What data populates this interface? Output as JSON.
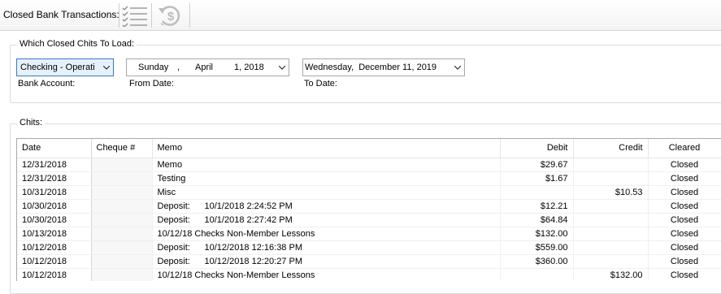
{
  "toolbar": {
    "title": "Closed Bank Transactions:",
    "checklist_icon": "checklist-icon",
    "undo_money_icon": "undo-dollar-icon"
  },
  "load_group": {
    "title": "Which Closed Chits To Load:",
    "bank_account": {
      "value": "Checking - Operati",
      "label": "Bank Account:"
    },
    "from_date": {
      "weekday": "Sunday",
      "sep": ",",
      "month": "April",
      "day_year": "1, 2018",
      "label": "From Date:"
    },
    "to_date": {
      "value": "Wednesday,  December 11, 2019",
      "label": "To Date:"
    }
  },
  "chits_group": {
    "title": "Chits:",
    "columns": [
      "Date",
      "Cheque #",
      "Memo",
      "Debit",
      "Credit",
      "Cleared"
    ],
    "rows": [
      {
        "date": "12/31/2018",
        "cheque": "",
        "memo_a": "Memo",
        "memo_b": "",
        "debit": "$29.67",
        "credit": "",
        "cleared": "Closed"
      },
      {
        "date": "12/31/2018",
        "cheque": "",
        "memo_a": "Testing",
        "memo_b": "",
        "debit": "$1.67",
        "credit": "",
        "cleared": "Closed"
      },
      {
        "date": "10/31/2018",
        "cheque": "",
        "memo_a": "Misc",
        "memo_b": "",
        "debit": "",
        "credit": "$10.53",
        "cleared": "Closed"
      },
      {
        "date": "10/30/2018",
        "cheque": "",
        "memo_a": "Deposit:",
        "memo_b": "10/1/2018 2:24:52 PM",
        "debit": "$12.21",
        "credit": "",
        "cleared": "Closed"
      },
      {
        "date": "10/30/2018",
        "cheque": "",
        "memo_a": "Deposit:",
        "memo_b": "10/1/2018 2:27:42 PM",
        "debit": "$64.84",
        "credit": "",
        "cleared": "Closed"
      },
      {
        "date": "10/13/2018",
        "cheque": "",
        "memo_a": "10/12/18 Checks Non-Member Lessons",
        "memo_b": "",
        "debit": "$132.00",
        "credit": "",
        "cleared": "Closed"
      },
      {
        "date": "10/12/2018",
        "cheque": "",
        "memo_a": "Deposit:",
        "memo_b": "10/12/2018 12:16:38 PM",
        "debit": "$559.00",
        "credit": "",
        "cleared": "Closed"
      },
      {
        "date": "10/12/2018",
        "cheque": "",
        "memo_a": "Deposit:",
        "memo_b": "10/12/2018 12:20:27 PM",
        "debit": "$360.00",
        "credit": "",
        "cleared": "Closed"
      },
      {
        "date": "10/12/2018",
        "cheque": "",
        "memo_a": "10/12/18 Checks Non-Member Lessons",
        "memo_b": "",
        "debit": "",
        "credit": "$132.00",
        "cleared": "Closed"
      }
    ]
  }
}
